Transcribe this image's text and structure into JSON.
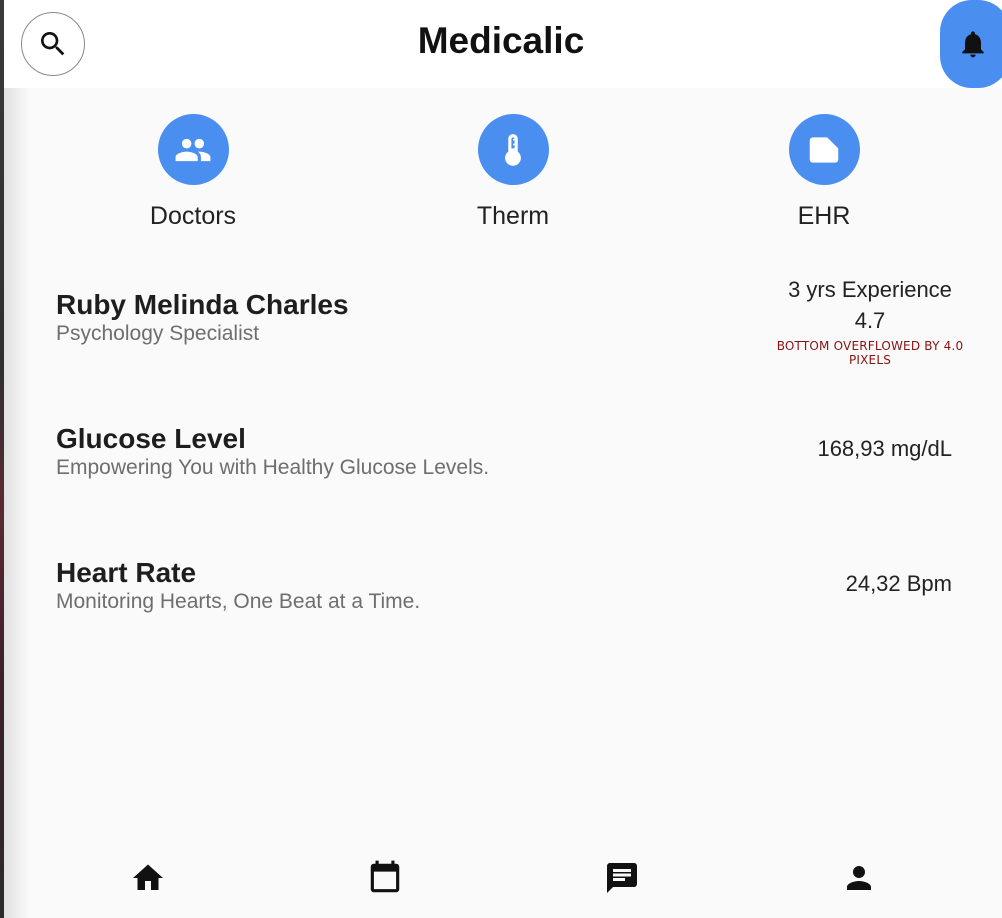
{
  "app": {
    "title": "Medicalic"
  },
  "icons": {
    "search": "search-icon",
    "notifications": "bell-icon",
    "doctors": "group-icon",
    "therm": "thermometer-icon",
    "ehr": "folder-icon",
    "home": "home-icon",
    "calendar": "calendar-icon",
    "messages": "chat-icon",
    "profile": "person-icon"
  },
  "colors": {
    "accent": "#4a8ff0",
    "overflow_text": "#8b1010"
  },
  "quick_actions": [
    {
      "label": "Doctors"
    },
    {
      "label": "Therm"
    },
    {
      "label": "EHR"
    }
  ],
  "doctor": {
    "name": "Ruby Melinda Charles",
    "specialty": "Psychology Specialist",
    "experience": "3 yrs Experience",
    "rating": "4.7",
    "overflow_message": "BOTTOM OVERFLOWED BY 4.0 PIXELS"
  },
  "metrics": [
    {
      "title": "Glucose Level",
      "subtitle": "Empowering You with Healthy Glucose Levels.",
      "value": "168,93 mg/dL"
    },
    {
      "title": "Heart Rate",
      "subtitle": "Monitoring Hearts, One Beat at a Time.",
      "value": "24,32 Bpm"
    }
  ]
}
